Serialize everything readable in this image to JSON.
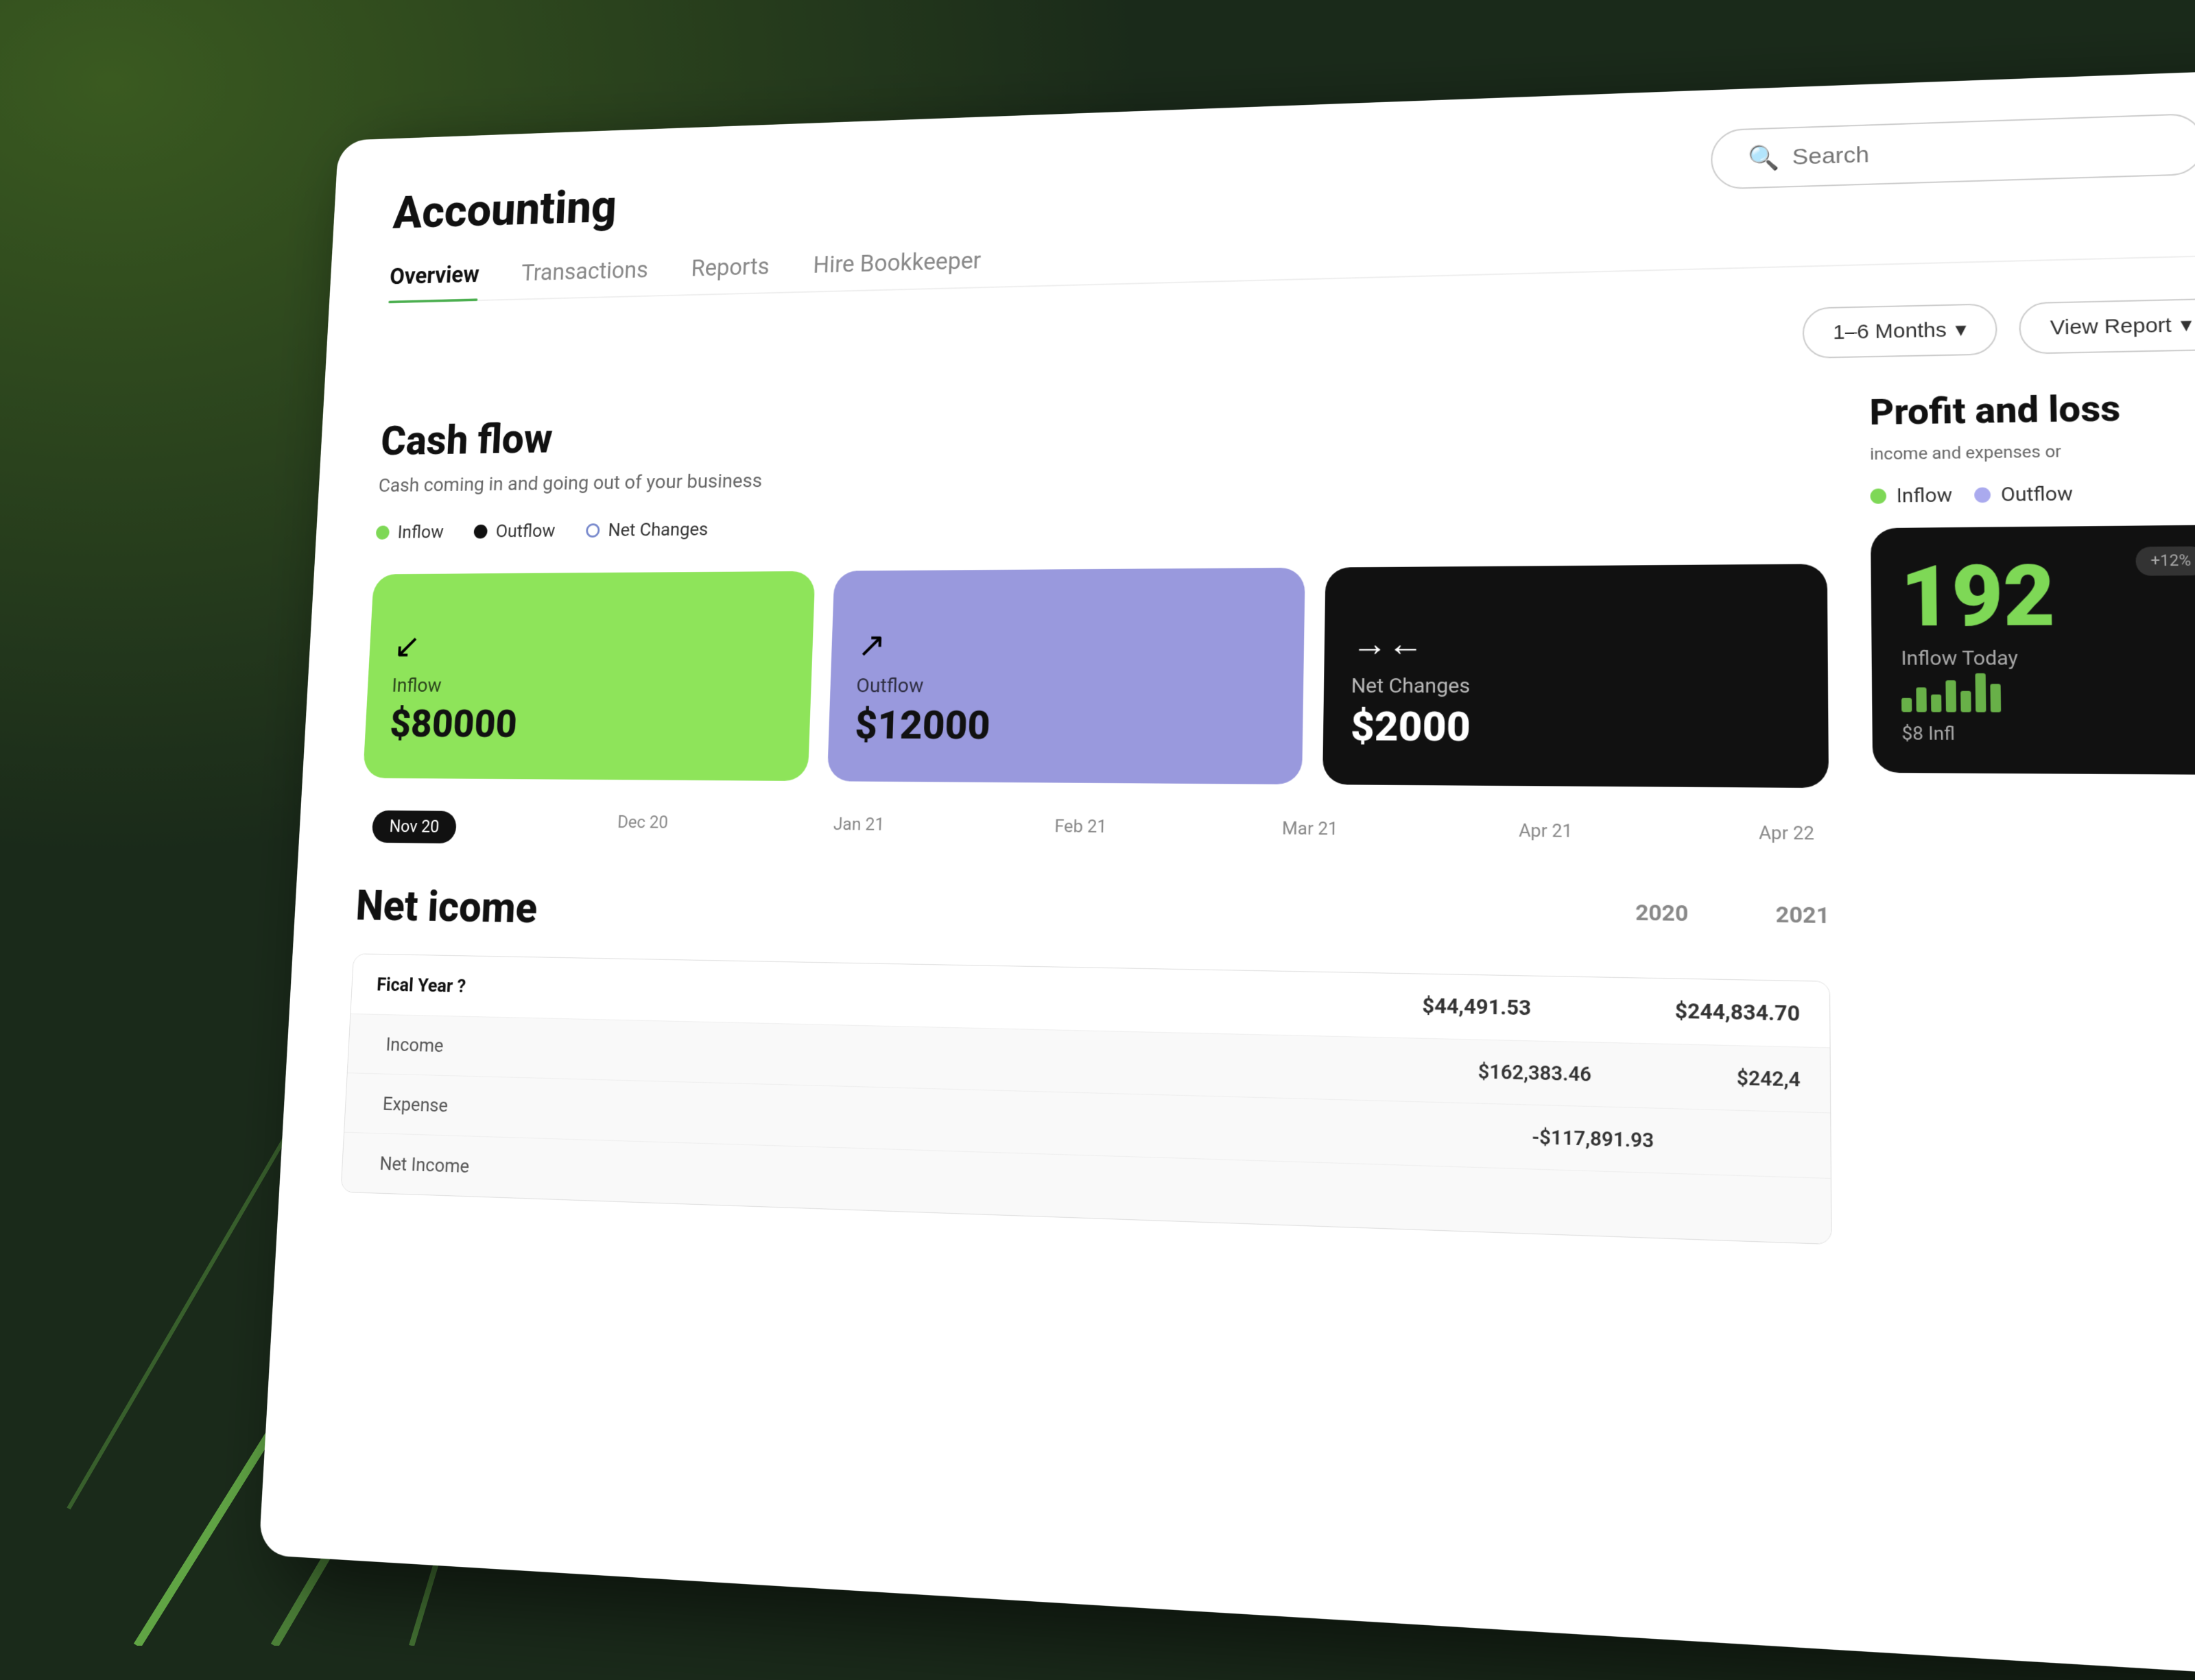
{
  "app": {
    "title": "Accounting",
    "search_placeholder": "Search"
  },
  "nav": {
    "tabs": [
      {
        "label": "Overview",
        "active": true
      },
      {
        "label": "Transactions",
        "active": false
      },
      {
        "label": "Reports",
        "active": false
      },
      {
        "label": "Hire Bookkeeper",
        "active": false
      }
    ]
  },
  "filters": {
    "period_label": "1–6 Months",
    "view_report_label": "View Report"
  },
  "cashflow": {
    "title": "Cash flow",
    "subtitle": "Cash coming in and going out of your business",
    "legend": {
      "inflow": "Inflow",
      "outflow": "Outflow",
      "net_changes": "Net Changes"
    },
    "cards": [
      {
        "type": "inflow",
        "icon": "↙",
        "label": "Inflow",
        "value": "$80000",
        "color": "green"
      },
      {
        "type": "outflow",
        "icon": "↗",
        "label": "Outflow",
        "value": "$12000",
        "color": "purple"
      },
      {
        "type": "net_changes",
        "icon": "→←",
        "label": "Net Changes",
        "value": "$2000",
        "color": "dark"
      }
    ],
    "timeline": [
      "Nov 20",
      "Dec 20",
      "Jan 21",
      "Feb 21",
      "Mar 21",
      "Apr 21",
      "Apr 22"
    ]
  },
  "net_income": {
    "title": "Net icome",
    "years": [
      "2020",
      "2021"
    ],
    "rows": [
      {
        "label": "Fical Year ?",
        "value_2020": "$44,491.53",
        "value_2021": "$244,834.70",
        "type": "header"
      },
      {
        "label": "Income",
        "value_2020": "$162,383.46",
        "value_2021": "$242,4",
        "type": "sub"
      },
      {
        "label": "Expense",
        "value_2020": "-$117,891.93",
        "value_2021": "",
        "type": "sub"
      },
      {
        "label": "Net Income",
        "value_2020": "",
        "value_2021": "",
        "type": "sub"
      }
    ]
  },
  "profit_loss": {
    "title": "Profit and loss",
    "subtitle": "income and expenses or",
    "legend": {
      "inflow": "Inflow",
      "outflow": "Outflow"
    },
    "inflow_today": {
      "big_number": "192",
      "label": "Inflow Today",
      "badge": "+12%",
      "sub_value": "$8",
      "sub_label": "Infl"
    }
  }
}
